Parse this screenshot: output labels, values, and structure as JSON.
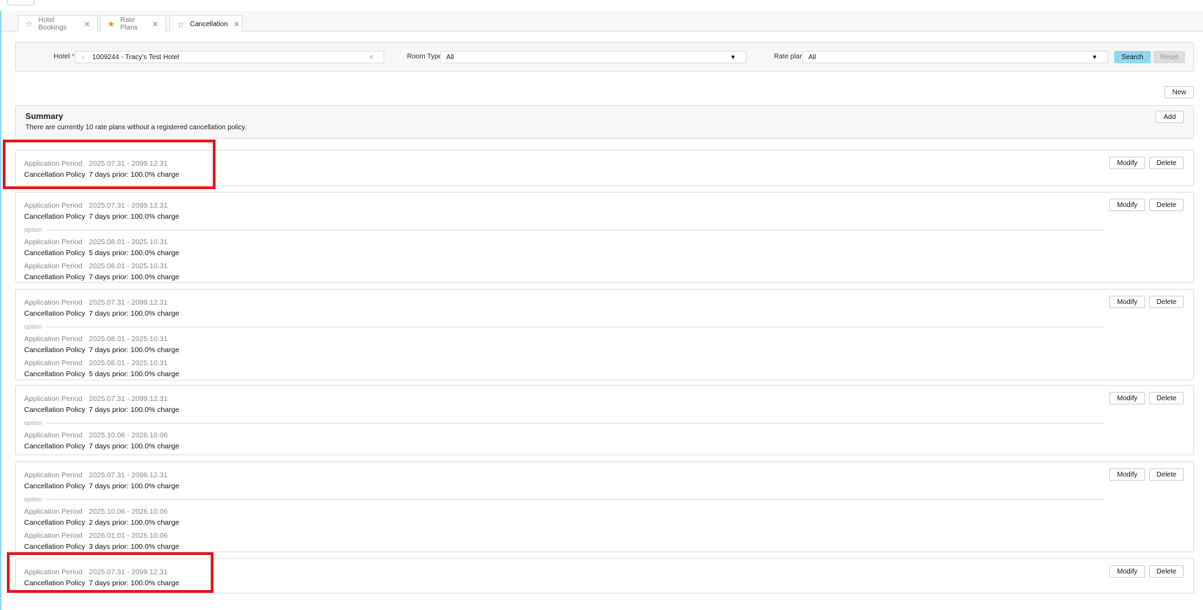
{
  "tabs": [
    {
      "label": "Hotel Bookings",
      "favorite": false
    },
    {
      "label": "Rate Plans",
      "favorite": true
    },
    {
      "label": "Cancellation",
      "favorite": false,
      "active": true
    }
  ],
  "filters": {
    "hotel_label": "Hotel",
    "required_mark": "*",
    "hotel_value": "1009244 - Tracy's Test Hotel",
    "room_type_label": "Room Type",
    "room_type_value": "All",
    "rate_plan_label": "Rate plan",
    "rate_plan_value": "All",
    "search": "Search",
    "reset": "Reset"
  },
  "new_label": "New",
  "summary": {
    "title": "Summary",
    "text": "There are currently 10 rate plans without a registered cancellation policy.",
    "add": "Add"
  },
  "labels": {
    "period": "Application Period",
    "policy": "Cancellation Policy",
    "option": "option",
    "modify": "Modify",
    "delete": "Delete"
  },
  "cards": [
    {
      "main": {
        "period": "2025.07.31 - 2099.12.31",
        "policy": "7 days prior: 100.0% charge"
      },
      "options": []
    },
    {
      "main": {
        "period": "2025.07.31 - 2099.12.31",
        "policy": "7 days prior: 100.0% charge"
      },
      "options": [
        {
          "period": "2025.08.01 - 2025.10.31",
          "policy": "5 days prior: 100.0% charge"
        },
        {
          "period": "2025.08.01 - 2025.10.31",
          "policy": "7 days prior: 100.0% charge"
        }
      ]
    },
    {
      "main": {
        "period": "2025.07.31 - 2099.12.31",
        "policy": "7 days prior: 100.0% charge"
      },
      "options": [
        {
          "period": "2025.08.01 - 2025.10.31",
          "policy": "7 days prior: 100.0% charge"
        },
        {
          "period": "2025.08.01 - 2025.10.31",
          "policy": "5 days prior: 100.0% charge"
        }
      ]
    },
    {
      "main": {
        "period": "2025.07.31 - 2099.12.31",
        "policy": "7 days prior: 100.0% charge"
      },
      "options": [
        {
          "period": "2025.10.06 - 2026.10.06",
          "policy": "7 days prior: 100.0% charge"
        }
      ]
    },
    {
      "main": {
        "period": "2025.07.31 - 2099.12.31",
        "policy": "7 days prior: 100.0% charge"
      },
      "options": [
        {
          "period": "2025.10.06 - 2026.10.06",
          "policy": "2 days prior: 100.0% charge"
        },
        {
          "period": "2026.01.01 - 2026.10.06",
          "policy": "3 days prior: 100.0% charge"
        }
      ]
    },
    {
      "main": {
        "period": "2025.07.31 - 2099.12.31",
        "policy": "7 days prior: 100.0% charge"
      },
      "options": []
    }
  ],
  "colors": {
    "accent": "#8fd8f0",
    "highlight": "#e3161b",
    "favorite": "#f08228"
  }
}
